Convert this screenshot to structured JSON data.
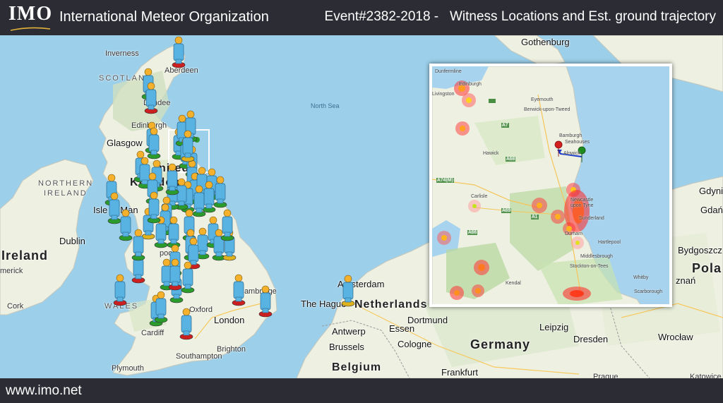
{
  "header": {
    "logo": "IMO",
    "org_name": "International Meteor Organization",
    "event_title": "Event#2382-2018 -   Witness Locations and Est. ground trajectory"
  },
  "footer": {
    "url": "www.imo.net"
  },
  "colors": {
    "header_bg": "#2c2c35",
    "sea": "#9ccfea",
    "land": "#f2efe6",
    "witness_body": "#58b3e3",
    "head": "#f5b12c",
    "base_green": "#2b9b2b",
    "base_red": "#cc1f1f",
    "base_yellow": "#e0b21c",
    "trajectory": "#1738c9"
  },
  "map_labels": {
    "inverness": "Inverness",
    "aberdeen": "Aberdeen",
    "scotland": "SCOTLAND",
    "dundee": "Dundee",
    "edinburgh": "Edinburgh",
    "glasgow": "Glasgow",
    "united_kingdom_1": "nited",
    "united_kingdom_2": "Kingdom",
    "north_sea": "North Sea",
    "northern_ireland_1": "NORTHERN",
    "northern_ireland_2": "IRELAND",
    "isle_of_man": "Isle of Man",
    "dublin": "Dublin",
    "ireland": "Ireland",
    "limerick": "merick",
    "cork": "Cork",
    "wales": "WALES",
    "oxford": "Oxford",
    "london": "London",
    "cambridge": "Cambridge",
    "cardiff": "Cardiff",
    "brighton": "Brighton",
    "southampton": "Southampton",
    "plymouth": "Plymouth",
    "liverpool": "pool",
    "gothenburg": "Gothenburg",
    "amsterdam": "Amsterdam",
    "the_hague": "The Hague",
    "netherlands": "Netherlands",
    "antwerp": "Antwerp",
    "brussels": "Brussels",
    "belgium": "Belgium",
    "dortmund": "Dortmund",
    "essen": "Essen",
    "cologne": "Cologne",
    "germany": "Germany",
    "leipzig": "Leipzig",
    "dresden": "Dresden",
    "frankfurt": "Frankfurt",
    "prague": "Prague",
    "wroclaw": "Wrocław",
    "katowice": "Katowice",
    "gdynia": "Gdynia",
    "gdansk": "Gdań",
    "bydgoszcz": "Bydgoszcz",
    "poland": "Pola",
    "poznan": "znań"
  },
  "inset_labels": {
    "dunfermline": "Dunfermline",
    "livingston": "Livingston",
    "edinburgh": "Edinburgh",
    "eyemouth": "Eyemouth",
    "berwick": "Berwick-upon-Tweed",
    "bamburgh": "Bamburgh",
    "seahouses": "Seahouses",
    "hawick": "Hawick",
    "carlisle": "Carlisle",
    "newcastle_1": "Newcastle",
    "newcastle_2": "upon Tyne",
    "sunderland": "Sunderland",
    "durham": "Durham",
    "hartlepool": "Hartlepool",
    "middlesbrough": "Middlesbrough",
    "stockton": "Stockton-on-Tees",
    "whitby": "Whitby",
    "scarborough": "Scarborough",
    "kendal": "Kendal",
    "alnwick": "Alnwick",
    "road_a7": "A7",
    "road_a68": "A68",
    "road_a74m": "A74(M)",
    "road_a1": "A1",
    "road_a66": "A66",
    "road_a69": "A69"
  }
}
